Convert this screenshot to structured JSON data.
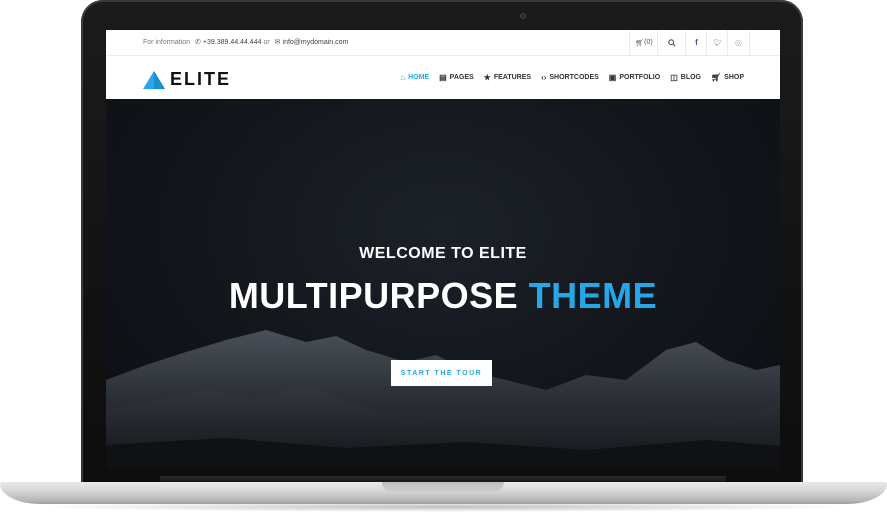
{
  "topbar": {
    "info_label": "For information",
    "phone": "+39.389.44.44.444",
    "or": "or",
    "email": "info@mydomain.com",
    "cart": "(0)"
  },
  "brand": {
    "name": "ELITE"
  },
  "nav": {
    "items": [
      {
        "label": "HOME",
        "icon": "home-icon",
        "active": true
      },
      {
        "label": "PAGES",
        "icon": "pages-icon",
        "active": false
      },
      {
        "label": "FEATURES",
        "icon": "star-icon",
        "active": false
      },
      {
        "label": "SHORTCODES",
        "icon": "code-icon",
        "active": false
      },
      {
        "label": "PORTFOLIO",
        "icon": "briefcase-icon",
        "active": false
      },
      {
        "label": "BLOG",
        "icon": "book-icon",
        "active": false
      },
      {
        "label": "SHOP",
        "icon": "cart-icon",
        "active": false
      }
    ]
  },
  "hero": {
    "welcome": "WELCOME TO ELITE",
    "headline_main": "MULTIPURPOSE",
    "headline_accent": "THEME",
    "cta": "START THE TOUR"
  },
  "colors": {
    "accent": "#26a8e8",
    "hero_bg": "#12161b"
  }
}
